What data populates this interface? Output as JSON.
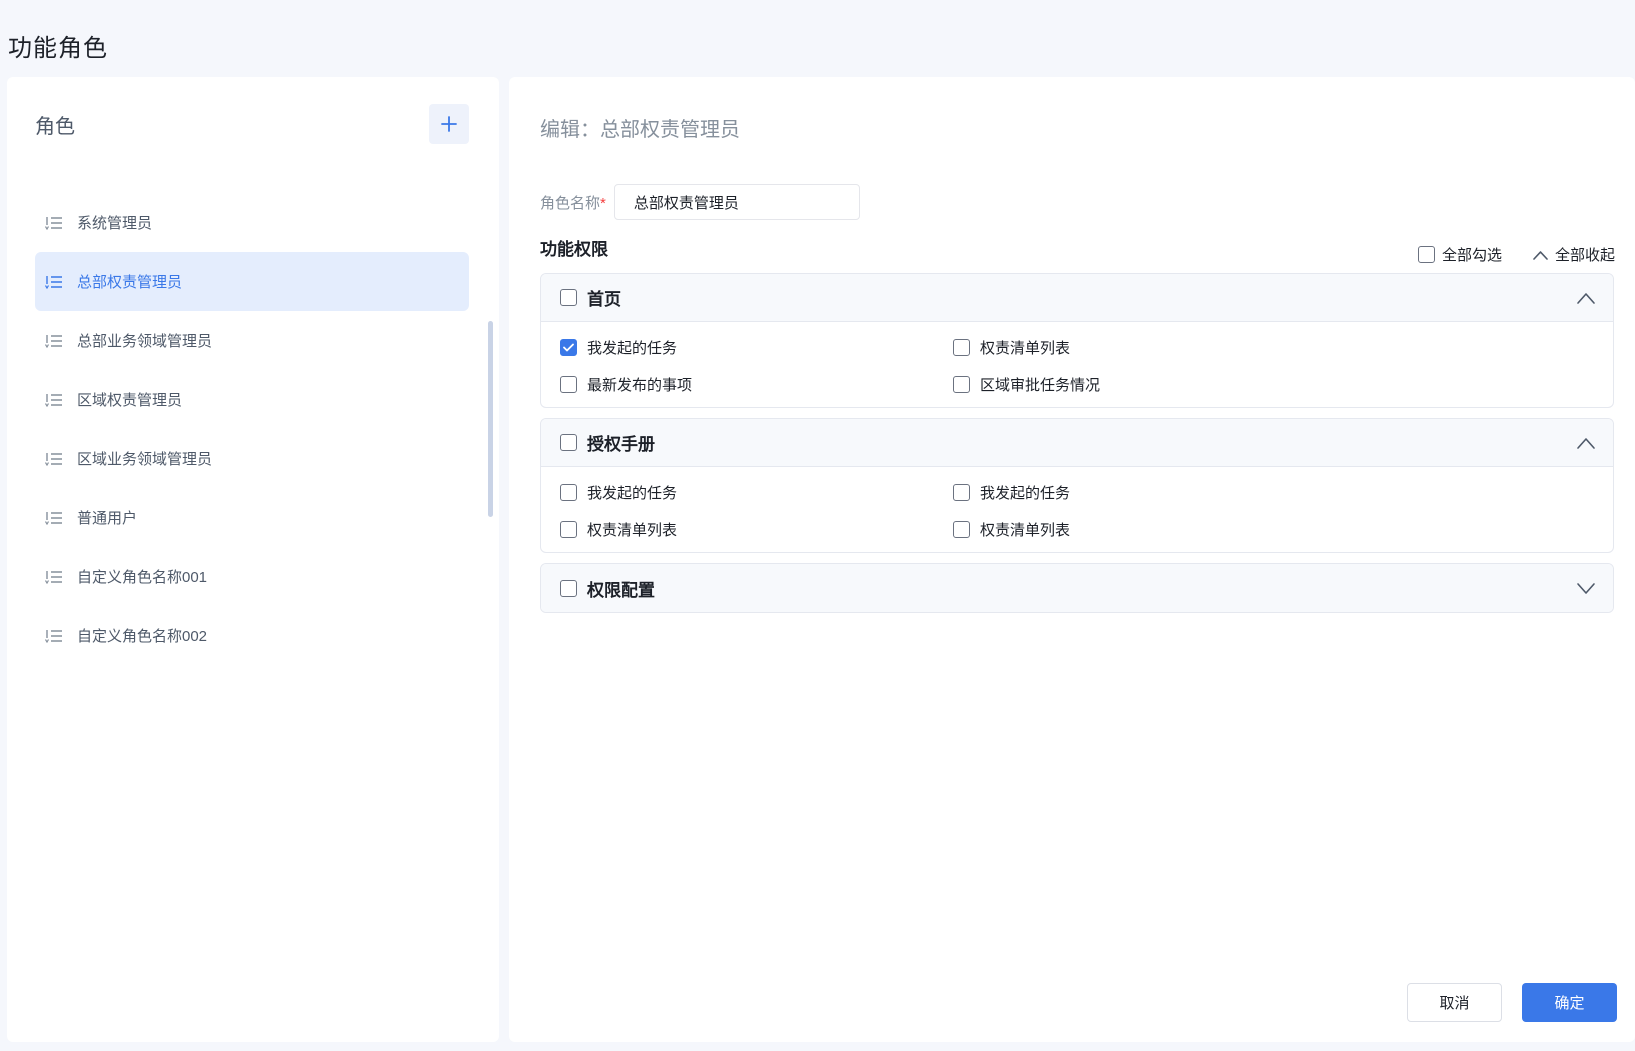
{
  "page": {
    "title": "功能角色"
  },
  "roles_panel": {
    "title": "角色",
    "add_icon": "plus-icon",
    "items": [
      {
        "label": "系统管理员",
        "active": false
      },
      {
        "label": "总部权责管理员",
        "active": true
      },
      {
        "label": "总部业务领域管理员",
        "active": false
      },
      {
        "label": "区域权责管理员",
        "active": false
      },
      {
        "label": "区域业务领域管理员",
        "active": false
      },
      {
        "label": "普通用户",
        "active": false
      },
      {
        "label": "自定义角色名称001",
        "active": false
      },
      {
        "label": "自定义角色名称002",
        "active": false
      }
    ]
  },
  "editor": {
    "title": "编辑：总部权责管理员",
    "role_name_label": "角色名称",
    "role_name_required_mark": "*",
    "role_name_value": "总部权责管理员",
    "permissions_title": "功能权限",
    "select_all_label": "全部勾选",
    "collapse_all_label": "全部收起",
    "groups": [
      {
        "name": "首页",
        "expanded": true,
        "checked": false,
        "items": [
          {
            "label": "我发起的任务",
            "checked": true
          },
          {
            "label": "权责清单列表",
            "checked": false
          },
          {
            "label": "最新发布的事项",
            "checked": false
          },
          {
            "label": "区域审批任务情况",
            "checked": false
          }
        ]
      },
      {
        "name": "授权手册",
        "expanded": true,
        "checked": false,
        "items": [
          {
            "label": "我发起的任务",
            "checked": false
          },
          {
            "label": "我发起的任务",
            "checked": false
          },
          {
            "label": "权责清单列表",
            "checked": false
          },
          {
            "label": "权责清单列表",
            "checked": false
          }
        ]
      },
      {
        "name": "权限配置",
        "expanded": false,
        "checked": false,
        "items": []
      }
    ]
  },
  "footer": {
    "cancel_label": "取消",
    "confirm_label": "确定"
  },
  "colors": {
    "accent": "#3a78e8",
    "active_bg": "#e4edfd",
    "page_bg": "#f5f7fc"
  }
}
